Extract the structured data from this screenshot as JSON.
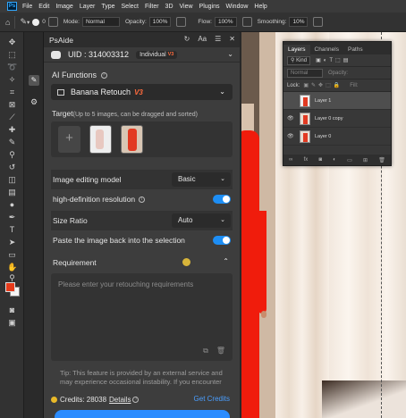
{
  "menubar": {
    "logo": "Ps",
    "items": [
      "File",
      "Edit",
      "Image",
      "Layer",
      "Type",
      "Select",
      "Filter",
      "3D",
      "View",
      "Plugins",
      "Window",
      "Help"
    ]
  },
  "options_bar": {
    "brush_size": "0",
    "mode_label": "Mode:",
    "mode_value": "Normal",
    "opacity_label": "Opacity:",
    "opacity_value": "100%",
    "flow_label": "Flow:",
    "flow_value": "100%",
    "smoothing_label": "Smoothing:",
    "smoothing_value": "10%"
  },
  "plugin": {
    "title": "PsAide",
    "uid_label": "UID : 314003312",
    "plan": "Individual",
    "plan_tag": "V3",
    "ai_functions_label": "AI Functions",
    "function_selected": "Banana Retouch",
    "function_tag": "V3",
    "target_label": "Target",
    "target_hint": "(Up to 5 images, can be dragged and sorted)",
    "image_model_label": "Image editing model",
    "image_model_value": "Basic",
    "hd_label": "high-definition resolution",
    "hd_enabled": true,
    "size_ratio_label": "Size Ratio",
    "size_ratio_value": "Auto",
    "paste_label": "Paste the image back into the selection",
    "paste_enabled": true,
    "requirement_label": "Requirement",
    "requirement_placeholder": "Please enter your retouching requirements",
    "tip_text": "Tip: This feature is provided by an external service and may experience occasional instability. If you encounter",
    "credits_label": "Credits: 28038",
    "details_label": "Details",
    "get_credits_label": "Get Credits"
  },
  "layers_panel": {
    "tabs": [
      "Layers",
      "Channels",
      "Paths"
    ],
    "filter_kind": "Kind",
    "blend_mode": "Normal",
    "opacity_label": "Opacity:",
    "lock_label": "Lock:",
    "fill_label": "Fill:",
    "layers": [
      {
        "name": "Layer 1",
        "visible": false,
        "selected": true
      },
      {
        "name": "Layer 0 copy",
        "visible": true,
        "selected": false
      },
      {
        "name": "Layer 0",
        "visible": true,
        "selected": false
      }
    ]
  },
  "colors": {
    "accent": "#2b8cff",
    "foreground": "#e63a1a",
    "background": "#f4f4f4",
    "v3_tag": "#ff6b3d"
  }
}
